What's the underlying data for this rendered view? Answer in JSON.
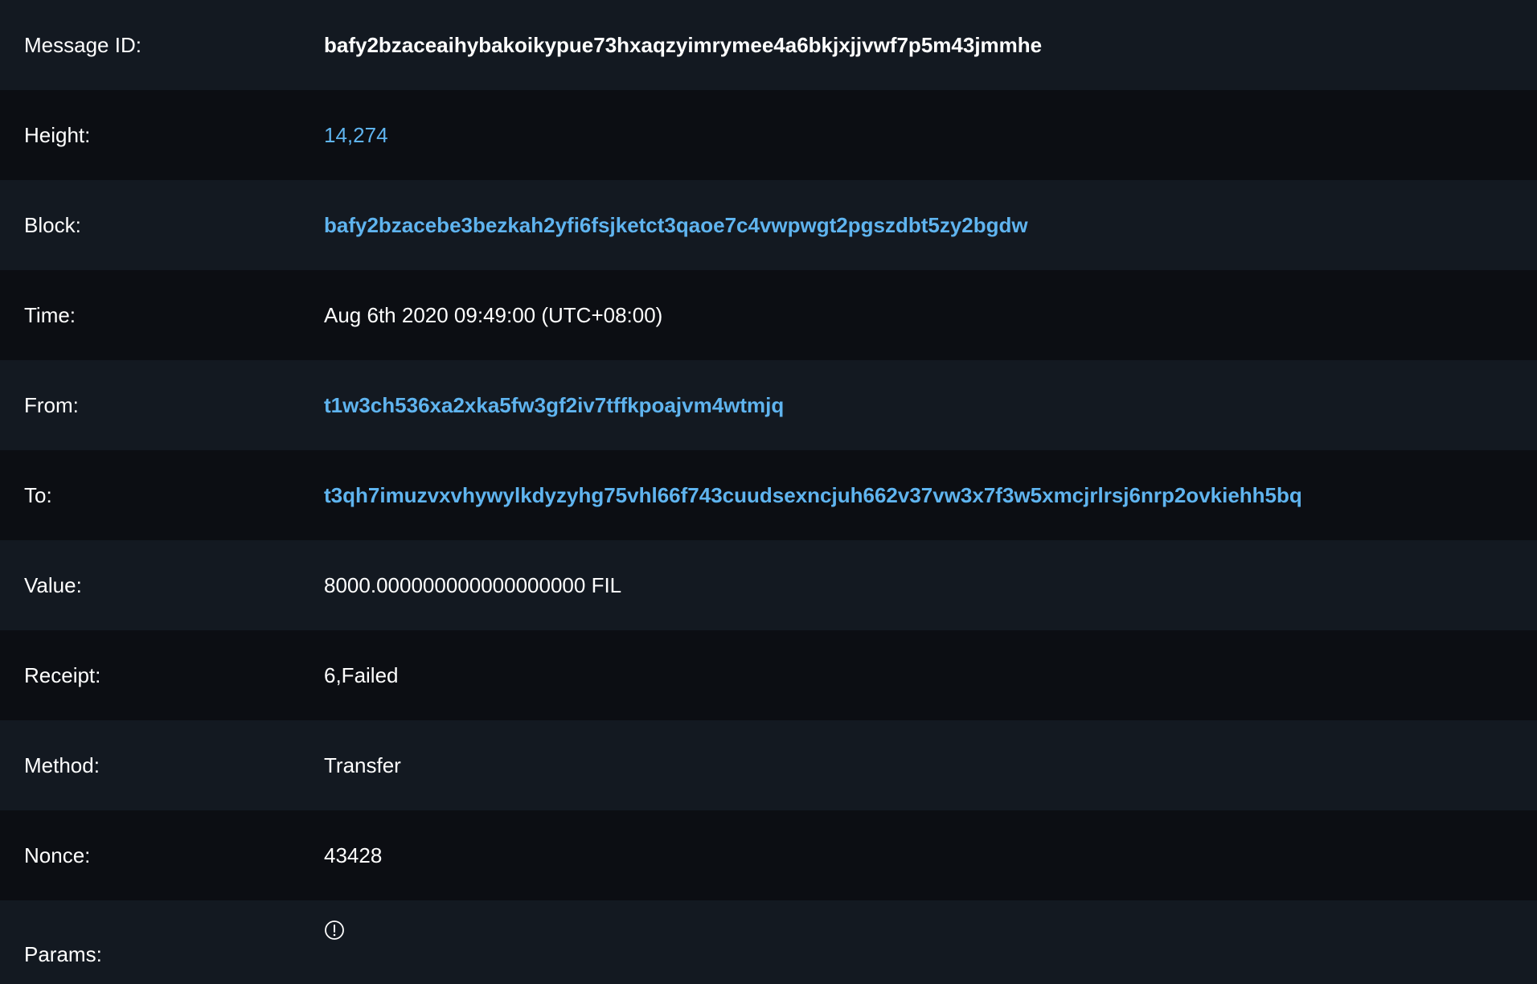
{
  "message": {
    "rows": [
      {
        "label": "Message ID:",
        "value": "bafy2bzaceaihybakoikypue73hxaqzyimrymee4a6bkjxjjvwf7p5m43jmmhe"
      },
      {
        "label": "Height:",
        "value": "14,274"
      },
      {
        "label": "Block:",
        "value": "bafy2bzacebe3bezkah2yfi6fsjketct3qaoe7c4vwpwgt2pgszdbt5zy2bgdw"
      },
      {
        "label": "Time:",
        "value": "Aug 6th 2020 09:49:00 (UTC+08:00)"
      },
      {
        "label": "From:",
        "value": "t1w3ch536xa2xka5fw3gf2iv7tffkpoajvm4wtmjq"
      },
      {
        "label": "To:",
        "value": "t3qh7imuzvxvhywylkdyzyhg75vhl66f743cuudsexncjuh662v37vw3x7f3w5xmcjrlrsj6nrp2ovkiehh5bq"
      },
      {
        "label": "Value:",
        "value": "8000.000000000000000000 FIL"
      },
      {
        "label": "Receipt:",
        "value": "6,Failed"
      },
      {
        "label": "Method:",
        "value": "Transfer"
      },
      {
        "label": "Nonce:",
        "value": "43428"
      },
      {
        "label": "Params:",
        "icon": "info-circle-icon"
      }
    ]
  },
  "colors": {
    "link": "#5fb4ef",
    "row_alt": "#131921",
    "row_base": "#0c0e13",
    "text": "#ffffff"
  }
}
